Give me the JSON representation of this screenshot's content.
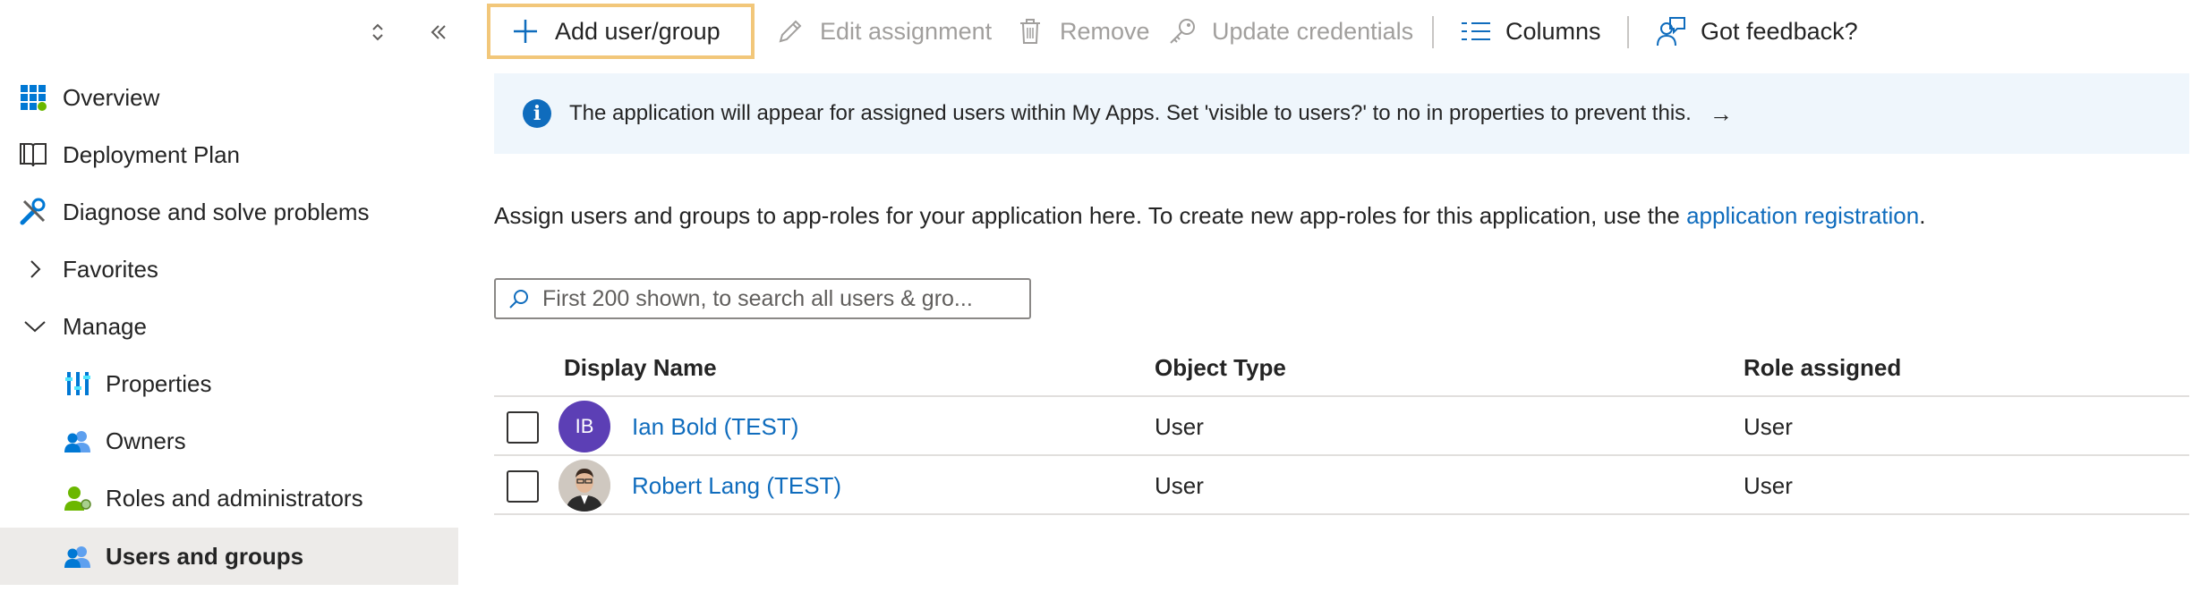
{
  "sidebar": {
    "items": [
      {
        "label": "Overview",
        "icon": "overview-grid-icon"
      },
      {
        "label": "Deployment Plan",
        "icon": "book-icon"
      },
      {
        "label": "Diagnose and solve problems",
        "icon": "tools-icon"
      },
      {
        "label": "Favorites",
        "icon": "chevron-right-icon"
      },
      {
        "label": "Manage",
        "icon": "chevron-down-icon"
      },
      {
        "label": "Properties",
        "icon": "properties-icon"
      },
      {
        "label": "Owners",
        "icon": "owners-icon"
      },
      {
        "label": "Roles and administrators",
        "icon": "roles-icon"
      },
      {
        "label": "Users and groups",
        "icon": "users-groups-icon"
      }
    ]
  },
  "toolbar": {
    "add_label": "Add user/group",
    "edit_label": "Edit assignment",
    "remove_label": "Remove",
    "update_label": "Update credentials",
    "columns_label": "Columns",
    "feedback_label": "Got feedback?"
  },
  "info": {
    "text": "The application will appear for assigned users within My Apps. Set 'visible to users?' to no in properties to prevent this.",
    "arrow": "→"
  },
  "description": {
    "text": "Assign users and groups to app-roles for your application here. To create new app-roles for this application, use the ",
    "link": "application registration",
    "suffix": "."
  },
  "search": {
    "placeholder": "First 200 shown, to search all users & gro..."
  },
  "table": {
    "headers": [
      "Display Name",
      "Object Type",
      "Role assigned"
    ],
    "rows": [
      {
        "initials": "IB",
        "name": "Ian Bold (TEST)",
        "type": "User",
        "role": "User"
      },
      {
        "initials": "",
        "name": "Robert Lang (TEST)",
        "type": "User",
        "role": "User"
      }
    ]
  },
  "colors": {
    "accent": "#0f6cbd",
    "avatar_ib": "#5c3fb5",
    "add_focus_border": "#f2c77a",
    "info_bg": "#eff6fc",
    "selected_nav_bg": "#edebe9"
  }
}
